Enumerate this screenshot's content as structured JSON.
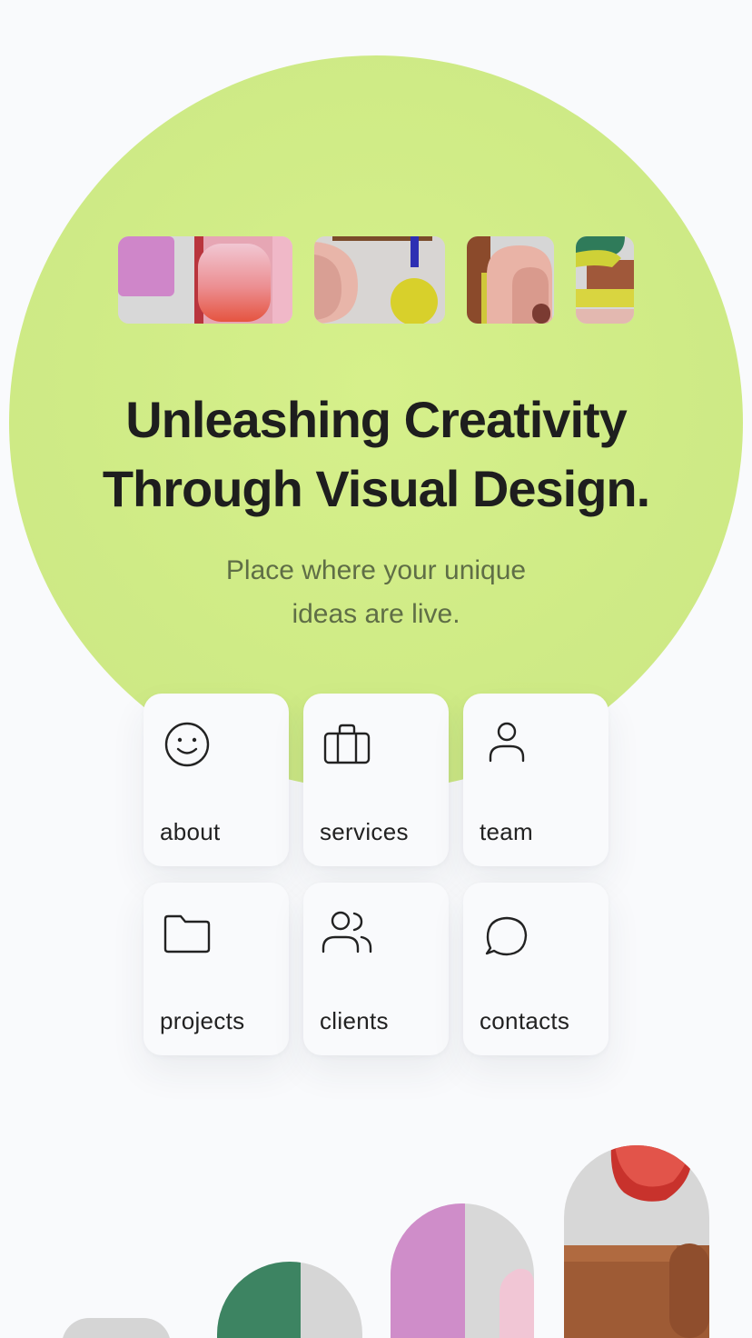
{
  "hero": {
    "headline_line1": "Unleashing Creativity",
    "headline_line2": "Through Visual Design.",
    "subtitle_line1": "Place where your unique",
    "subtitle_line2": "ideas are live."
  },
  "thumbnails": [
    {
      "name": "thumb-pink-blocks"
    },
    {
      "name": "thumb-arch-yellow-disc"
    },
    {
      "name": "thumb-brown-arch"
    },
    {
      "name": "thumb-green-leaf"
    }
  ],
  "nav_tiles": [
    {
      "label": "about",
      "icon": "smiley-icon"
    },
    {
      "label": "services",
      "icon": "briefcase-icon"
    },
    {
      "label": "team",
      "icon": "user-icon"
    },
    {
      "label": "projects",
      "icon": "folder-icon"
    },
    {
      "label": "clients",
      "icon": "users-icon"
    },
    {
      "label": "contacts",
      "icon": "chat-bubble-icon"
    }
  ],
  "colors": {
    "hero_circle": "#cfeb86",
    "background": "#f9fafc",
    "headline": "#1e1e1e",
    "subtitle": "#5f6e46"
  }
}
